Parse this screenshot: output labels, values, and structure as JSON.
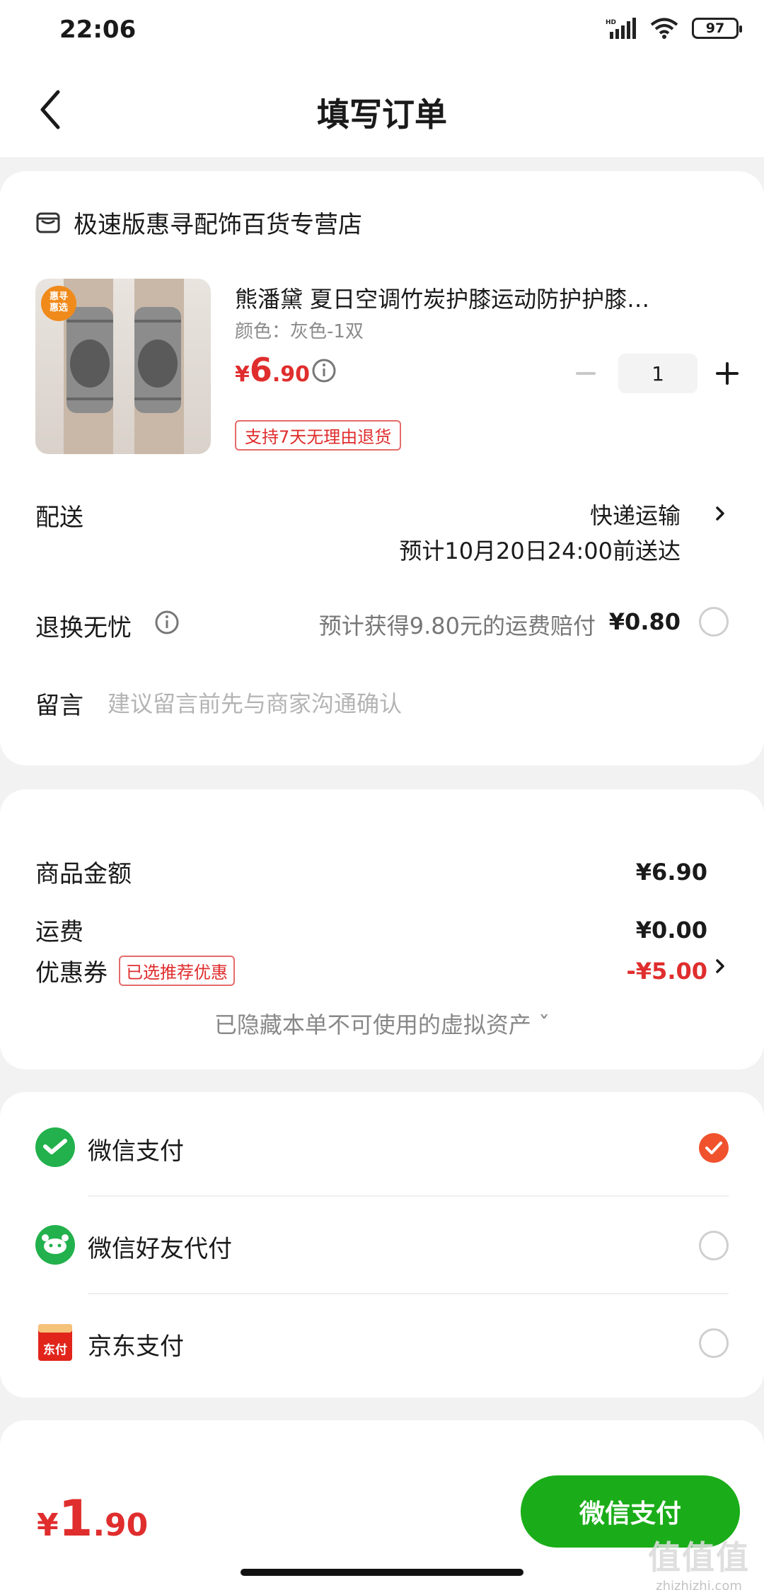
{
  "status": {
    "time": "22:06",
    "battery": "97",
    "network": "HD"
  },
  "nav": {
    "title": "填写订单"
  },
  "order": {
    "shop_name": "极速版惠寻配饰百货专营店",
    "product": {
      "badge": "惠寻\n惠选",
      "title": "熊潘黛 夏日空调竹炭护膝运动防护护膝…",
      "spec": "颜色：灰色-1双",
      "price_yen": "¥",
      "price_int": "6",
      "price_dec": ".90",
      "quantity": "1",
      "return_tag": "支持7天无理由退货"
    },
    "delivery": {
      "label": "配送",
      "method": "快递运输",
      "eta": "预计10月20日24:00前送达"
    },
    "worry_free": {
      "label": "退换无忧",
      "desc": "预计获得9.80元的运费赔付",
      "price": "¥0.80"
    },
    "note": {
      "label": "留言",
      "placeholder": "建议留言前先与商家沟通确认"
    }
  },
  "fees": {
    "goods_label": "商品金额",
    "goods_value": "¥6.90",
    "shipping_label": "运费",
    "shipping_value": "¥0.00",
    "coupon_label": "优惠券",
    "coupon_tag": "已选推荐优惠",
    "coupon_value": "-¥5.00",
    "hidden_assets": "已隐藏本单不可使用的虚拟资产 ˇ"
  },
  "payment_methods": [
    {
      "label": "微信支付",
      "icon": "wechat-pay-icon",
      "selected": true
    },
    {
      "label": "微信好友代付",
      "icon": "wechat-friend-pay-icon",
      "selected": false
    },
    {
      "label": "京东支付",
      "icon": "jd-pay-icon",
      "icon_text": "东付",
      "selected": false
    }
  ],
  "bottom": {
    "total_yen": "¥",
    "total_int": "1",
    "total_dec": ".90",
    "pay_button": "微信支付"
  },
  "watermark": {
    "logo": "值值值",
    "url": "zhizhizhi.com"
  },
  "colors": {
    "accent_red": "#e02d2d",
    "wechat_green": "#1aad19",
    "check_orange": "#f0522d"
  }
}
